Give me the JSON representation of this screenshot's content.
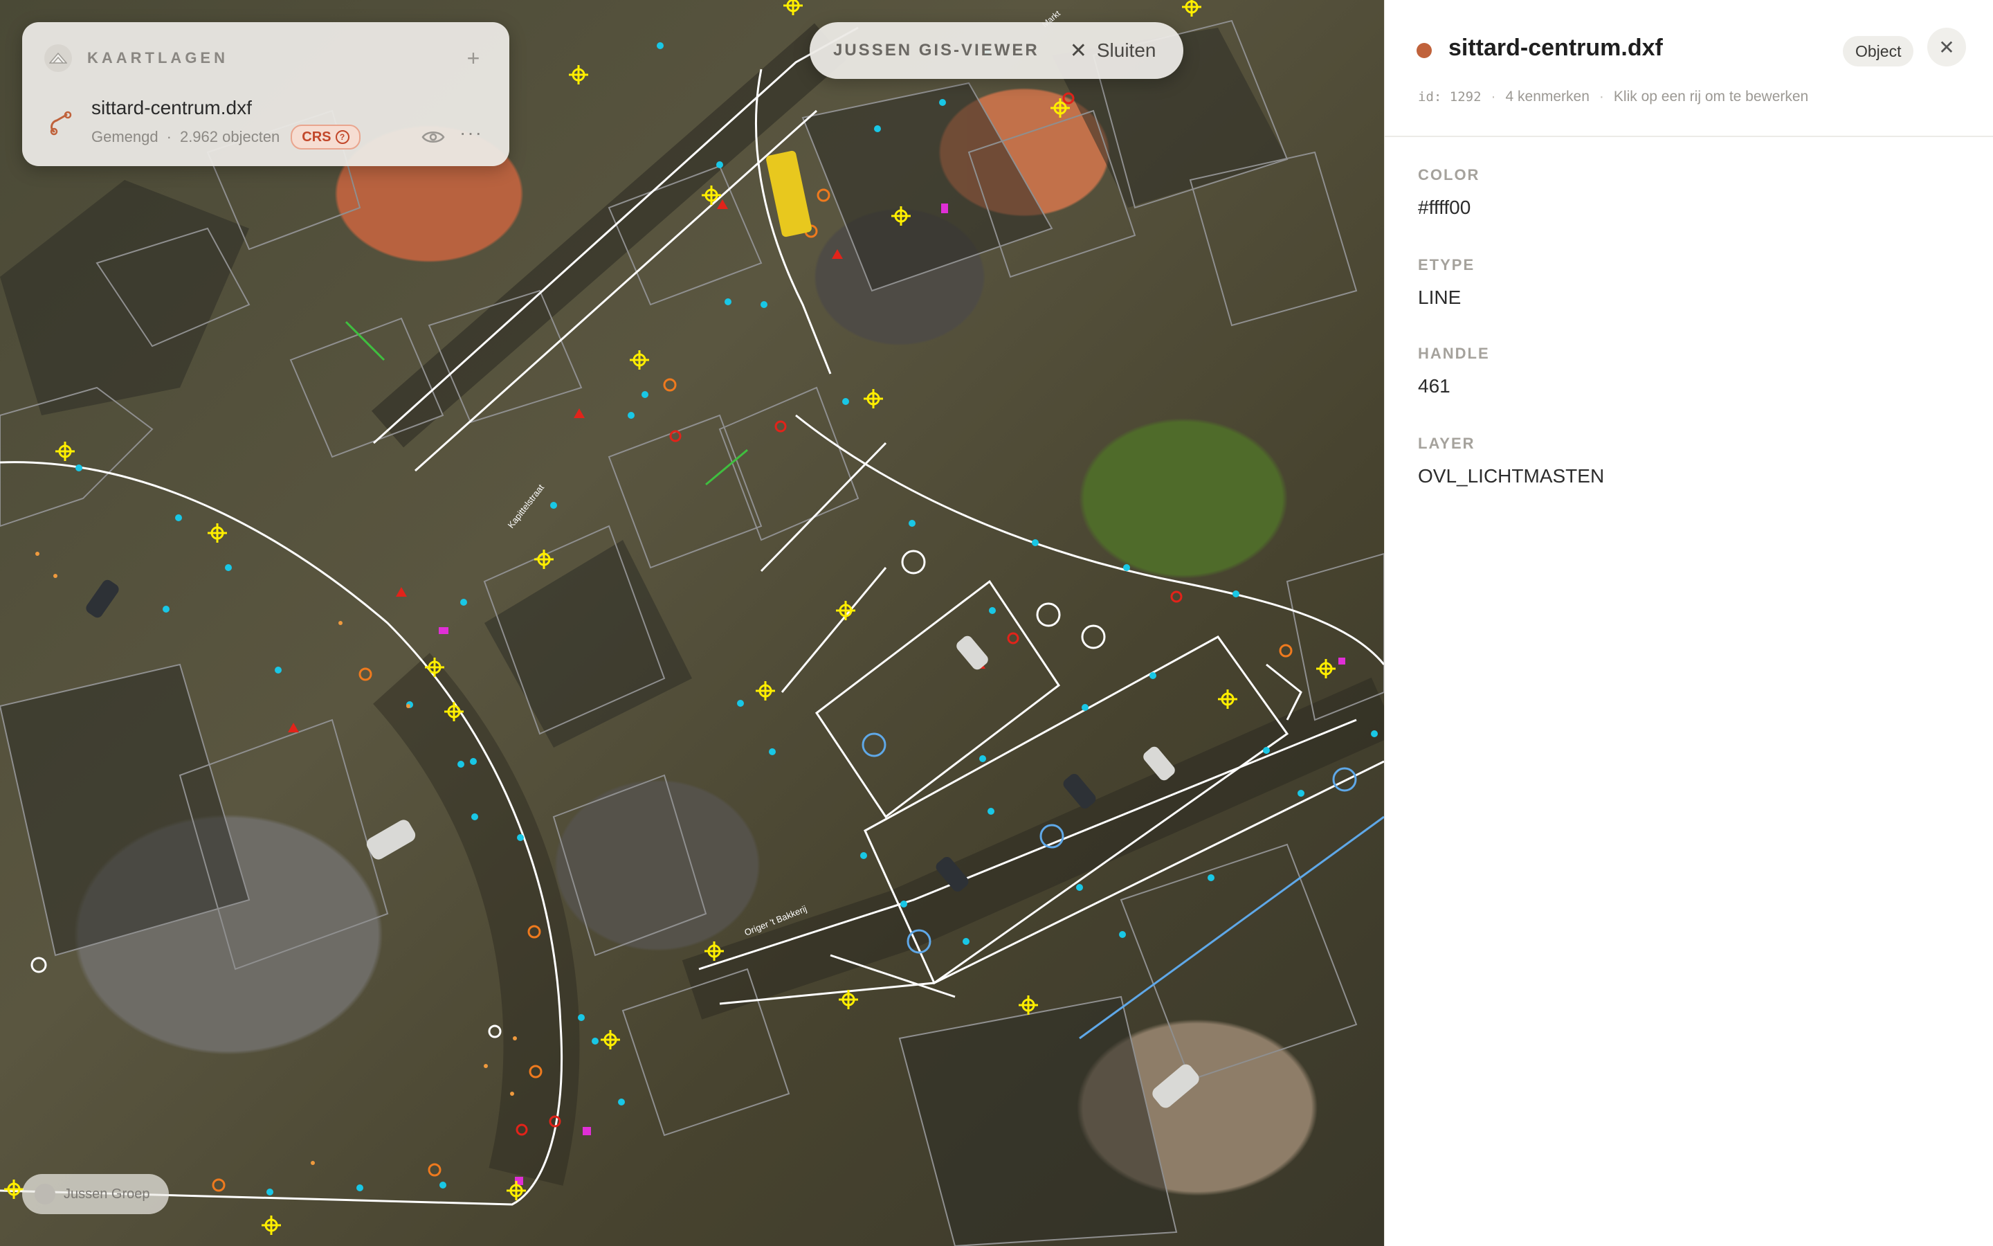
{
  "layer_panel": {
    "title": "KAARTLAGEN",
    "add_label": "+",
    "layer": {
      "filename": "sittard-centrum.dxf",
      "type": "Gemengd",
      "separator": "·",
      "object_count": "2.962 objecten",
      "crs_label": "CRS",
      "more_label": "···"
    }
  },
  "top_pill": {
    "title": "JUSSEN GIS-VIEWER",
    "close_label": "Sluiten"
  },
  "brand": {
    "label": "Jussen Groep"
  },
  "map": {
    "street_labels": [
      "Kapittelstraat",
      "Origer 't Bakkerij",
      "Markt"
    ]
  },
  "details": {
    "title": "sittard-centrum.dxf",
    "chip": "Object",
    "id": "id: 1292",
    "attr_count": "4 kenmerken",
    "hint": "Klik op een rij om te bewerken",
    "separator": "·",
    "attributes": [
      {
        "key": "COLOR",
        "value": "#ffff00"
      },
      {
        "key": "ETYPE",
        "value": "LINE"
      },
      {
        "key": "HANDLE",
        "value": "461"
      },
      {
        "key": "LAYER",
        "value": "OVL_LICHTMASTEN"
      }
    ]
  },
  "colors": {
    "accent": "#c0623b",
    "line_white": "#ffffff",
    "line_grey": "#9a9a9a",
    "symbol_yellow": "#ffee00",
    "symbol_cyan": "#19c7e6",
    "symbol_red": "#e2231a",
    "symbol_orange": "#ef7a1e",
    "symbol_magenta": "#e02fd6"
  }
}
